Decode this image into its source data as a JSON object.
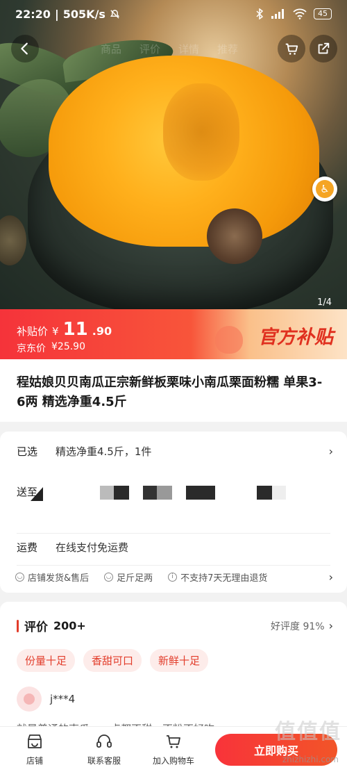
{
  "status_bar": {
    "time": "22:20",
    "speed": "505K/s",
    "battery": "45",
    "icons": [
      "bell-off-icon",
      "bluetooth-icon",
      "signal-icon",
      "wifi-icon"
    ]
  },
  "nav": {
    "tabs": [
      "商品",
      "评价",
      "详情",
      "推荐"
    ],
    "back_icon": "chevron-left-icon",
    "cart_icon": "cart-icon",
    "share_icon": "share-icon"
  },
  "hero": {
    "image_counter": "1/4"
  },
  "price": {
    "subsidy_label": "补贴价",
    "currency": "¥",
    "integer": "11",
    "decimal": ".90",
    "jd_label": "京东价",
    "jd_price": "¥25.90",
    "tag": "官方补贴"
  },
  "product": {
    "title": "程姑娘贝贝南瓜正宗新鲜板栗味小南瓜栗面粉糯 单果3-6两 精选净重4.5斤"
  },
  "selection": {
    "selected_key": "已选",
    "selected_value": "精选净重4.5斤，1件",
    "deliver_key": "送至",
    "shipping_key": "运费",
    "shipping_value": "在线支付免运费",
    "services": [
      "店铺发货&售后",
      "足斤足两",
      "不支持7天无理由退货"
    ]
  },
  "review": {
    "title": "评价",
    "count": "200+",
    "rating": "好评度 91%",
    "tags": [
      "份量十足",
      "香甜可口",
      "新鲜十足"
    ],
    "reviewer_name": "j***4",
    "review_text": "就是普通的南瓜，一点都不甜，不粉不好吃"
  },
  "bottom_bar": {
    "store": "店铺",
    "service": "联系客服",
    "add_cart": "加入购物车",
    "buy": "立即购买"
  },
  "watermark": {
    "main": "值值值",
    "sub": "zhizhizhi.com"
  },
  "colors": {
    "accent": "#e23c2a",
    "price_banner": "#f5333a"
  }
}
